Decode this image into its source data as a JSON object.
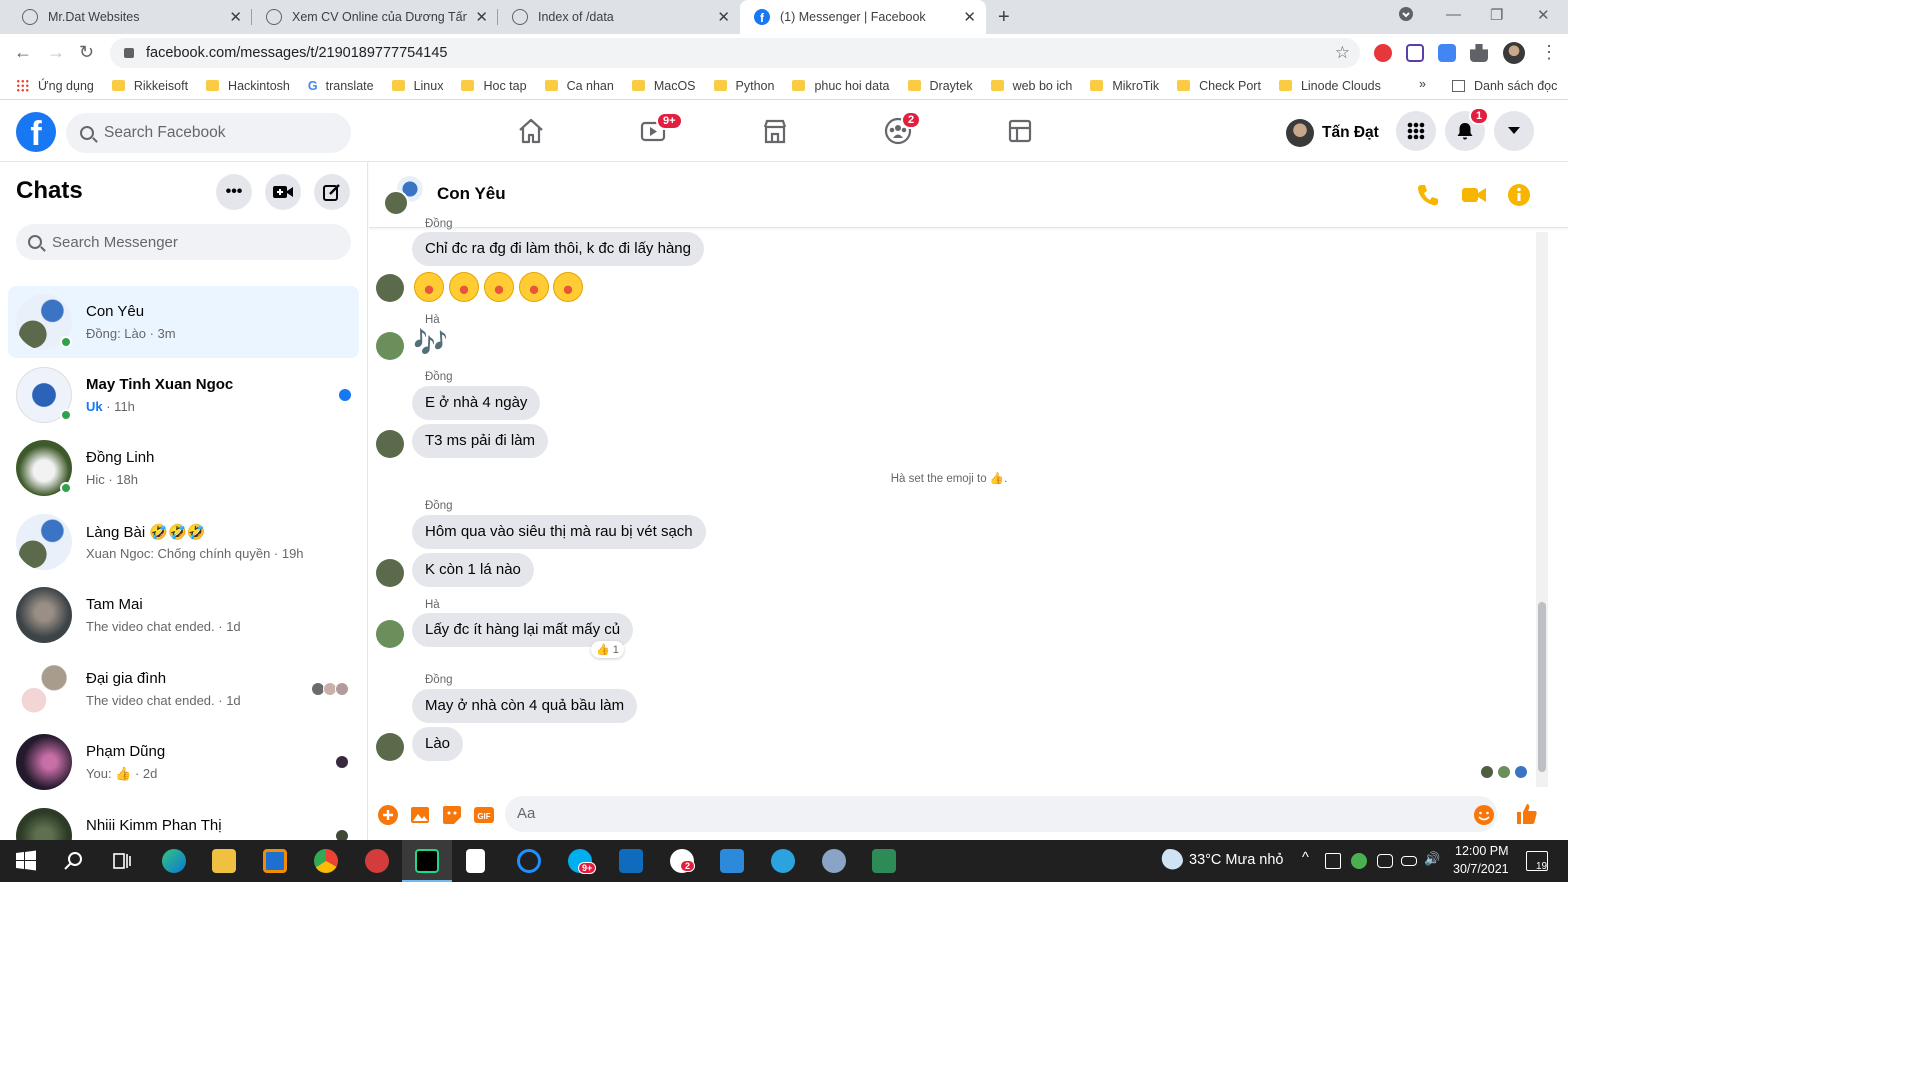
{
  "browser": {
    "tabs": [
      {
        "title": "Mr.Dat Websites"
      },
      {
        "title": "Xem CV Online của Dương Tấn Đ"
      },
      {
        "title": "Index of /data"
      },
      {
        "title": "(1) Messenger | Facebook"
      }
    ],
    "url": "facebook.com/messages/t/2190189777754145",
    "bookmarks": [
      "Ứng dụng",
      "Rikkeisoft",
      "Hackintosh",
      "translate",
      "Linux",
      "Hoc tap",
      "Ca nhan",
      "MacOS",
      "Python",
      "phuc hoi data",
      "Draytek",
      "web bo ich",
      "MikroTik",
      "Check Port",
      "Linode Clouds"
    ],
    "reading_list": "Danh sách đọc",
    "more": "»"
  },
  "fb": {
    "search_placeholder": "Search Facebook",
    "watch_badge": "9+",
    "groups_badge": "2",
    "notif_badge": "1",
    "user_name": "Tấn Đạt"
  },
  "sidebar": {
    "title": "Chats",
    "search_placeholder": "Search Messenger",
    "chats": [
      {
        "name": "Con Yêu",
        "preview": "Đồng: Lào · 3m"
      },
      {
        "name": "May Tinh Xuan Ngoc",
        "preview_strong": "Uk",
        "preview": " · 11h"
      },
      {
        "name": "Đồng Linh",
        "preview": "Hic · 18h"
      },
      {
        "name": "Làng Bài 🤣🤣🤣",
        "preview": "Xuan Ngoc: Chống chính quyền · 19h"
      },
      {
        "name": "Tam Mai",
        "preview": "The video chat ended. · 1d"
      },
      {
        "name": "Đại gia đình",
        "preview": "The video chat ended. · 1d"
      },
      {
        "name": "Phạm Dũng",
        "preview": "You: 👍 · 2d"
      },
      {
        "name": "Nhiii Kimm Phan Thị",
        "preview": ""
      }
    ]
  },
  "conversation": {
    "title": "Con Yêu",
    "messages": {
      "top_sender": "Đồng",
      "m1": "Chỉ đc ra đg đi làm thôi, k đc đi lấy hàng",
      "sender_ha1": "Hà",
      "notes": "🎶",
      "sender_dong1": "Đồng",
      "m2": "E ở nhà 4 ngày",
      "m3": "T3 ms pải đi làm",
      "system": "Hà set the emoji to 👍.",
      "sender_dong2": "Đồng",
      "m4": "Hôm qua vào siêu thị mà rau bị vét sạch",
      "m5": "K còn 1 lá nào",
      "sender_ha2": "Hà",
      "m6": "Lấy đc ít hàng lại mất mấy củ",
      "reaction": "👍 1",
      "sender_dong3": "Đồng",
      "m7": "May ở nhà còn 4 quả bầu làm",
      "m8": "Lào"
    },
    "composer_placeholder": "Aa"
  },
  "taskbar": {
    "weather": "33°C  Mưa nhỏ",
    "time": "12:00 PM",
    "date": "30/7/2021",
    "notif_count": "19",
    "zalo_badge": "2",
    "skype_badge": "9+"
  }
}
